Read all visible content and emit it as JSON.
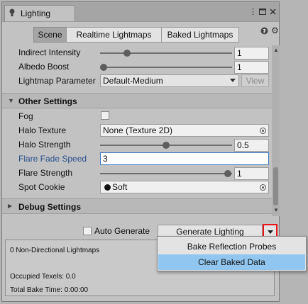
{
  "window": {
    "title": "Lighting",
    "tab_icon": "bulb-icon",
    "controls": [
      "menu-dots-icon",
      "maximize-icon",
      "close-icon"
    ]
  },
  "toolbar": {
    "tabs": [
      {
        "label": "Scene",
        "active": true
      },
      {
        "label": "Realtime Lightmaps",
        "active": false
      },
      {
        "label": "Baked Lightmaps",
        "active": false
      }
    ],
    "help_icon": "help-icon",
    "settings_icon": "gear-icon"
  },
  "lightmapping": {
    "indirect_intensity": {
      "label": "Indirect Intensity",
      "value": "1",
      "slider_fraction": 0.2
    },
    "albedo_boost": {
      "label": "Albedo Boost",
      "value": "1",
      "slider_fraction": 0.0
    },
    "lightmap_parameters": {
      "label": "Lightmap Parameter",
      "value": "Default-Medium",
      "view_label": "View"
    }
  },
  "other_settings": {
    "header": "Other Settings",
    "fog": {
      "label": "Fog",
      "checked": false
    },
    "halo_texture": {
      "label": "Halo Texture",
      "value": "None (Texture 2D)"
    },
    "halo_strength": {
      "label": "Halo Strength",
      "value": "0.5",
      "slider_fraction": 0.5
    },
    "flare_fade_speed": {
      "label": "Flare Fade Speed",
      "value": "3"
    },
    "flare_strength": {
      "label": "Flare Strength",
      "value": "1",
      "slider_fraction": 1.0
    },
    "spot_cookie": {
      "label": "Spot Cookie",
      "value": "Soft"
    }
  },
  "debug_settings": {
    "header": "Debug Settings"
  },
  "bake": {
    "auto_generate_label": "Auto Generate",
    "auto_generate_checked": false,
    "generate_label": "Generate Lighting"
  },
  "dropdown_menu": {
    "items": [
      {
        "label": "Bake Reflection Probes",
        "selected": false
      },
      {
        "label": "Clear Baked Data",
        "selected": true
      }
    ]
  },
  "stats": {
    "lightmaps": "0 Non-Directional Lightmaps",
    "occupied_texels": "Occupied Texels: 0.0",
    "total_bake_time": "Total Bake Time: 0:00:00"
  },
  "colors": {
    "highlight_border": "#e8141a",
    "label_focus": "#2a4f8f",
    "menu_selection": "#90c6ef"
  }
}
